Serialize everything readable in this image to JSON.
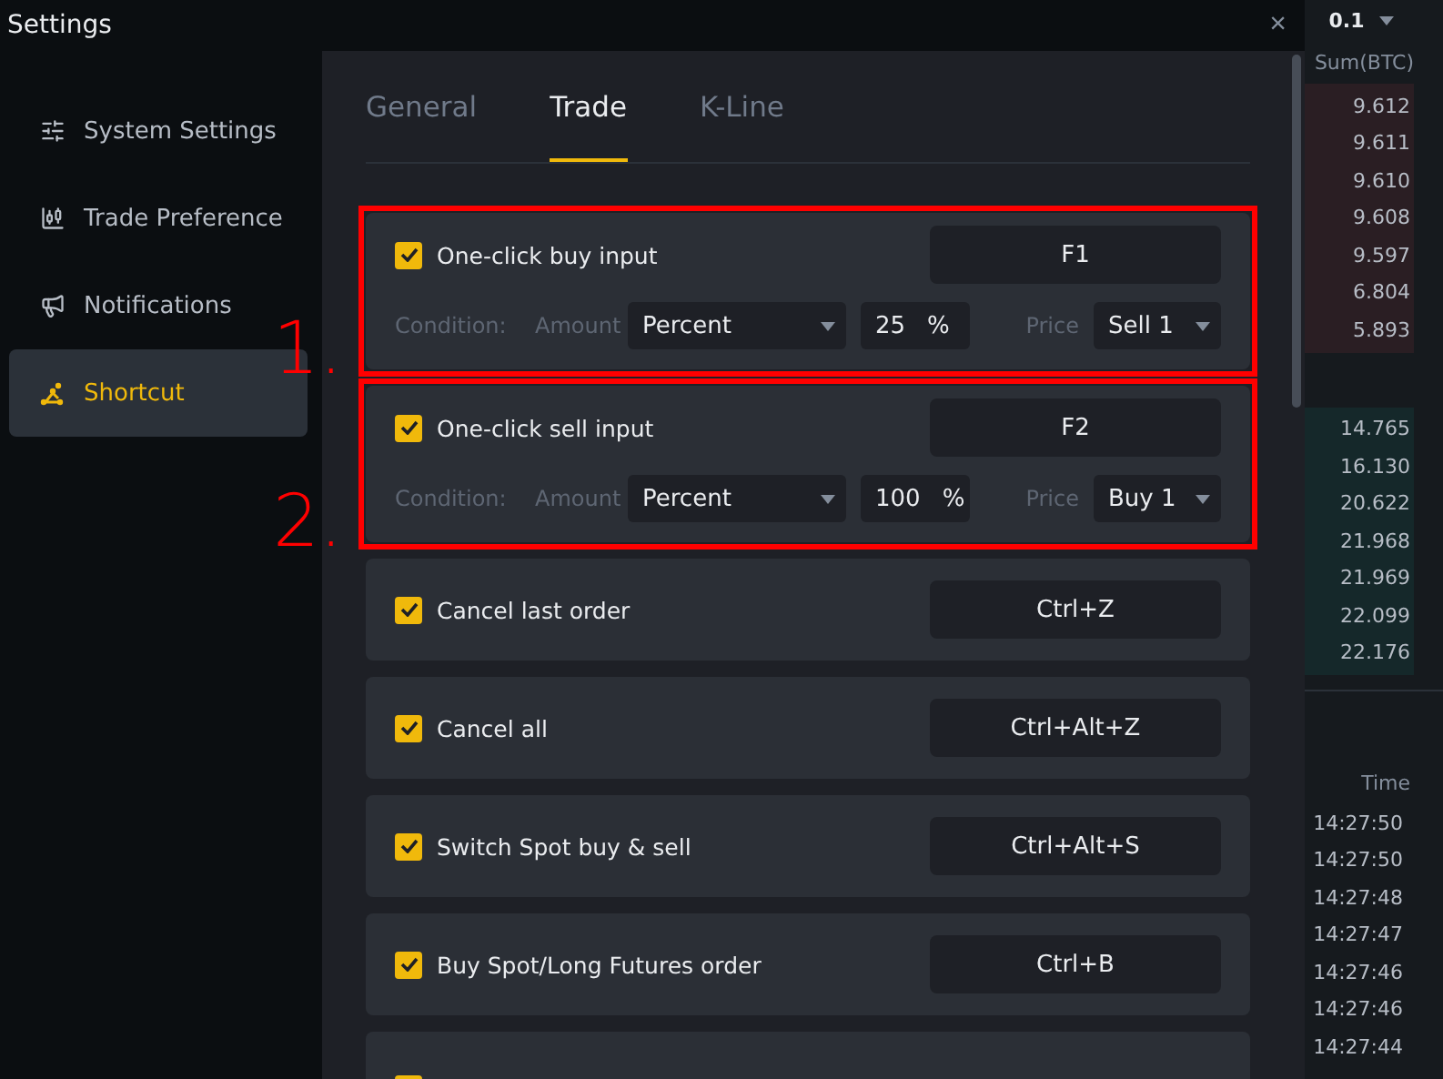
{
  "window": {
    "title": "Settings",
    "close": "×"
  },
  "sidebar": {
    "items": [
      {
        "label": "System Settings",
        "selected": false
      },
      {
        "label": "Trade Preference",
        "selected": false
      },
      {
        "label": "Notifications",
        "selected": false
      },
      {
        "label": "Shortcut",
        "selected": true
      }
    ]
  },
  "tabs": [
    {
      "label": "General",
      "selected": false
    },
    {
      "label": "Trade",
      "selected": true
    },
    {
      "label": "K-Line",
      "selected": false
    }
  ],
  "shortcuts": [
    {
      "kind": "conditional",
      "label": "One-click buy input",
      "checked": true,
      "key": "F1",
      "annotation": "1.",
      "condition": {
        "label": "Condition:",
        "amount_label": "Amount",
        "amount_mode": "Percent",
        "amount": "25",
        "unit": "%",
        "price_label": "Price",
        "price": "Sell 1"
      }
    },
    {
      "kind": "conditional",
      "label": "One-click sell input",
      "checked": true,
      "key": "F2",
      "annotation": "2.",
      "condition": {
        "label": "Condition:",
        "amount_label": "Amount",
        "amount_mode": "Percent",
        "amount": "100",
        "unit": "%",
        "price_label": "Price",
        "price": "Buy 1"
      }
    },
    {
      "kind": "simple",
      "label": "Cancel last order",
      "checked": true,
      "key": "Ctrl+Z"
    },
    {
      "kind": "simple",
      "label": "Cancel all",
      "checked": true,
      "key": "Ctrl+Alt+Z"
    },
    {
      "kind": "simple",
      "label": "Switch Spot buy & sell",
      "checked": true,
      "key": "Ctrl+Alt+S"
    },
    {
      "kind": "simple",
      "label": "Buy Spot/Long Futures order",
      "checked": true,
      "key": "Ctrl+B"
    },
    {
      "kind": "cut",
      "checked": true
    }
  ],
  "order_book": {
    "precision": "0.1",
    "column": "Sum(BTC)",
    "asks": [
      "9.612",
      "9.611",
      "9.610",
      "9.608",
      "9.597",
      "6.804",
      "5.893"
    ],
    "bids": [
      "14.765",
      "16.130",
      "20.622",
      "21.968",
      "21.969",
      "22.099",
      "22.176"
    ]
  },
  "trades": {
    "column": "Time",
    "times": [
      "14:27:50",
      "14:27:50",
      "14:27:48",
      "14:27:47",
      "14:27:46",
      "14:27:46",
      "14:27:44"
    ]
  }
}
